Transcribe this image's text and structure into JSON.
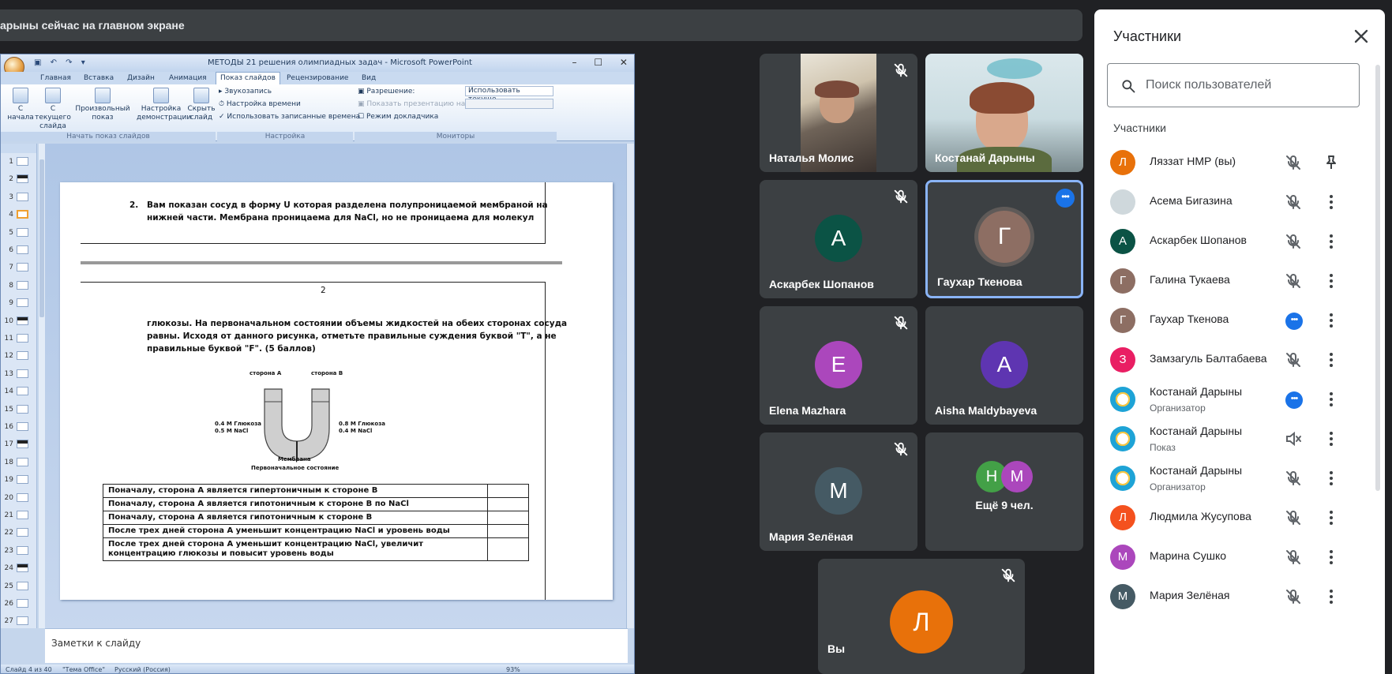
{
  "banner": {
    "text": "арыны сейчас на главном экране"
  },
  "ppt": {
    "window_title": "МЕТОДЫ 21 решения олимпиадных задач - Microsoft PowerPoint",
    "tabs": [
      "Главная",
      "Вставка",
      "Дизайн",
      "Анимация",
      "Показ слайдов",
      "Рецензирование",
      "Вид"
    ],
    "ribbon": {
      "from_start": "С начала",
      "from_current": "С текущего слайда",
      "custom_show": "Произвольный показ",
      "setup_show": "Настройка демонстрации",
      "hide_slide": "Скрыть слайд",
      "record_narration": "Звукозапись",
      "rehearse_timings": "Настройка времени",
      "use_timings": "Использовать записанные времена",
      "resolution_label": "Разрешение:",
      "resolution_value": "Использовать текуще...",
      "show_on_label": "Показать презентацию на:",
      "presenter_view": "Режим докладчика",
      "group_start": "Начать показ слайдов",
      "group_setup": "Настройка",
      "group_monitors": "Мониторы"
    },
    "thumbnails": [
      "1",
      "2",
      "3",
      "4",
      "5",
      "6",
      "7",
      "8",
      "9",
      "10",
      "11",
      "12",
      "13",
      "14",
      "15",
      "16",
      "17",
      "18",
      "19",
      "20",
      "21",
      "22",
      "23",
      "24",
      "25",
      "26",
      "27"
    ],
    "selected_slide": 4,
    "slide": {
      "q_number": "2.",
      "q_line1": "Вам показан сосуд в форму U которая разделена полупроницаемой мембраной на",
      "q_line2": "нижней части. Мембрана проницаема для NaCl, но не проницаема для молекул",
      "page_number": "2",
      "p2_line1": "глюкозы. На первоначальном состоянии объемы жидкостей на обеих сторонах сосуда",
      "p2_line2": "равны. Исходя от данного рисунка, отметьте правильные суждения буквой \"T\", а не",
      "p2_line3": "правильные буквой \"F\". (5 баллов)",
      "side_a": "сторона А",
      "side_b": "сторона В",
      "left_conc1": "0.4 M Глюкоза",
      "left_conc2": "0.5 M NaCl",
      "right_conc1": "0.8 M Глюкоза",
      "right_conc2": "0.4 M NaCl",
      "membrane": "Мембрана",
      "initial_state": "Первоначальное состояние",
      "rows": [
        "Поначалу, сторона А является гипертоничным к стороне В",
        "Поначалу, сторона А является гипотоничным к стороне В по NaCl",
        "Поначалу, сторона А является гипотоничным к стороне В",
        " После трех дней сторона А уменьшит концентрацию NaCl  и уровень воды",
        "После трех дней сторона А уменьшит концентрацию NaCl, увеличит концентрацию глюкозы и повысит уровень воды"
      ]
    },
    "notes_placeholder": "Заметки к слайду",
    "status": {
      "slide_info": "Слайд 4 из 40",
      "theme": "\"Тема Office\"",
      "language": "Русский (Россия)",
      "zoom": "93%"
    }
  },
  "tiles": [
    {
      "name": "Наталья Молис"
    },
    {
      "name": "Костанай Дарыны"
    },
    {
      "name": "Аскарбек Шопанов",
      "initial": "А",
      "color": "#0b5345"
    },
    {
      "name": "Гаухар Ткенова",
      "initial": "Г",
      "color": "#8d6e63"
    },
    {
      "name": "Elena Mazhara",
      "initial": "E",
      "color": "#ab47bc"
    },
    {
      "name": "Aisha Maldybayeva",
      "initial": "A",
      "color": "#5e35b1"
    },
    {
      "name": "Мария Зелёная",
      "initial": "М",
      "color": "#455a64"
    },
    {
      "name": "Ещё 9 чел.",
      "initial1": "Н",
      "initial2": "М"
    },
    {
      "name": "Вы",
      "initial": "Л",
      "color": "#e8710a"
    }
  ],
  "panel": {
    "title": "Участники",
    "search_placeholder": "Поиск пользователей",
    "section": "Участники",
    "people": [
      {
        "initial": "Л",
        "name": "Ляззат НМР (вы)",
        "color": "#e8710a"
      },
      {
        "initial": "",
        "name": "Асема Бигазина",
        "color": "#cfd8dc"
      },
      {
        "initial": "А",
        "name": "Аскарбек Шопанов",
        "color": "#0b5345"
      },
      {
        "initial": "Г",
        "name": "Галина Тукаева",
        "color": "#8d6e63"
      },
      {
        "initial": "Г",
        "name": "Гаухар Ткенова",
        "color": "#8d6e63"
      },
      {
        "initial": "З",
        "name": "Замзагуль Балтабаева",
        "color": "#e91e63"
      },
      {
        "initial": "",
        "name": "Костанай Дарыны",
        "role": "Организатор",
        "color": "#1ea3d6"
      },
      {
        "initial": "",
        "name": "Костанай Дарыны",
        "role": "Показ",
        "color": "#1ea3d6"
      },
      {
        "initial": "",
        "name": "Костанай Дарыны",
        "role": "Организатор",
        "color": "#1ea3d6"
      },
      {
        "initial": "Л",
        "name": "Людмила Жусупова",
        "color": "#f4511e"
      },
      {
        "initial": "М",
        "name": "Марина Сушко",
        "color": "#ab47bc"
      },
      {
        "initial": "М",
        "name": "Мария Зелёная",
        "color": "#455a64"
      }
    ]
  }
}
